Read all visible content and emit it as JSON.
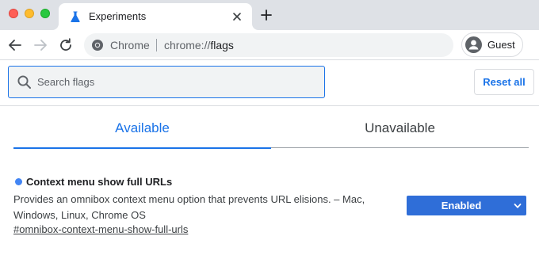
{
  "browser": {
    "tab": {
      "title": "Experiments"
    },
    "omnibox": {
      "site_chip": "Chrome",
      "url_prefix": "chrome://",
      "url_path": "flags"
    },
    "profile": {
      "label": "Guest"
    }
  },
  "flags": {
    "search": {
      "placeholder": "Search flags",
      "value": ""
    },
    "reset_label": "Reset all",
    "tabs": [
      {
        "label": "Available",
        "selected": true
      },
      {
        "label": "Unavailable",
        "selected": false
      }
    ],
    "experiment": {
      "title": "Context menu show full URLs",
      "description": "Provides an omnibox context menu option that prevents URL elisions. – Mac, Windows, Linux, Chrome OS",
      "link": "#omnibox-context-menu-show-full-urls",
      "state": "Enabled"
    }
  },
  "colors": {
    "accent": "#1a73e8",
    "select_bg": "#2f6ed8",
    "experiment_dot": "#4285f4",
    "tabstrip_bg": "#dee1e6"
  }
}
